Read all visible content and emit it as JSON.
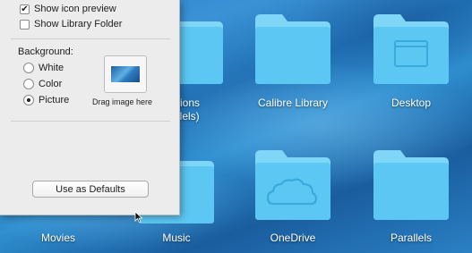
{
  "desktop": {
    "items": [
      {
        "label": "ations\nallels)",
        "icon": "folder-icon",
        "emblem": ""
      },
      {
        "label": "Calibre Library",
        "icon": "folder-icon",
        "emblem": ""
      },
      {
        "label": "Desktop",
        "icon": "folder-icon",
        "emblem": "window"
      },
      {
        "label": "Movies",
        "icon": "folder-icon",
        "emblem": ""
      },
      {
        "label": "Music",
        "icon": "folder-icon",
        "emblem": ""
      },
      {
        "label": "OneDrive",
        "icon": "folder-icon",
        "emblem": "cloud"
      },
      {
        "label": "Parallels",
        "icon": "folder-icon",
        "emblem": ""
      }
    ]
  },
  "panel": {
    "show_icon_preview": {
      "label": "Show icon preview",
      "checked": true
    },
    "show_library_folder": {
      "label": "Show Library Folder",
      "checked": false
    },
    "background_label": "Background:",
    "background_options": [
      {
        "label": "White",
        "selected": false
      },
      {
        "label": "Color",
        "selected": false
      },
      {
        "label": "Picture",
        "selected": true
      }
    ],
    "drag_image_label": "Drag image here",
    "use_as_defaults": "Use as Defaults"
  },
  "colors": {
    "folder": "#5cc7f3",
    "folder_tab": "#7fd6f7",
    "desktop_blue": "#2c7ac6",
    "panel_bg": "#ececec"
  }
}
